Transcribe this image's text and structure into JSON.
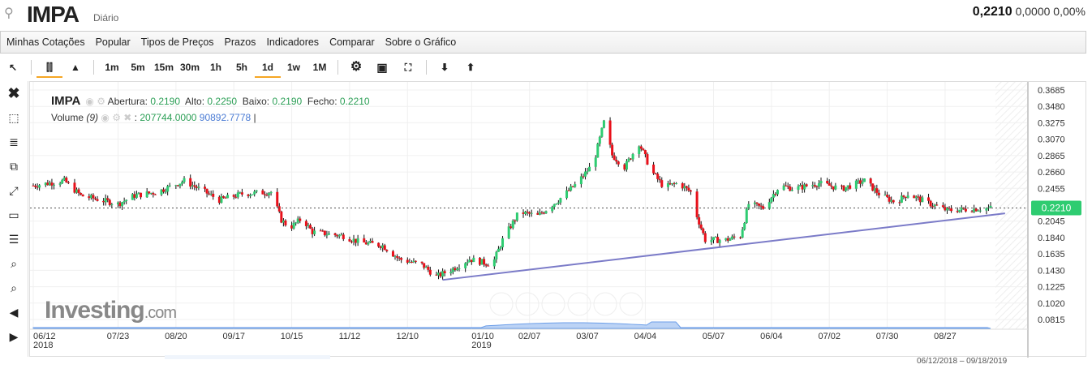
{
  "header": {
    "symbol": "IMPA",
    "period": "Diário",
    "price": "0,2210",
    "change": "0,0000",
    "change_pct": "0,00%"
  },
  "menu": [
    "Minhas Cotações",
    "Popular",
    "Tipos de Preços",
    "Prazos",
    "Indicadores",
    "Comparar",
    "Sobre o Gráfico"
  ],
  "toolbar": {
    "intervals": [
      "1m",
      "5m",
      "15m",
      "30m",
      "1h",
      "5h",
      "1d",
      "1w",
      "1M"
    ],
    "selected_interval": "1d",
    "icons": [
      "cursor-icon",
      "candlestick-icon",
      "area-chart-icon",
      "gear-icon",
      "camera-icon",
      "fullscreen-icon",
      "download-icon",
      "upload-icon"
    ]
  },
  "sidebar_icons": [
    "close-icon",
    "remove-drawings-icon",
    "fibonacci-icon",
    "clone-icon",
    "trendline-icon",
    "rectangle-icon",
    "horizontal-lines-icon",
    "zoom-in-icon",
    "zoom-out-icon",
    "scroll-left-icon",
    "scroll-right-icon"
  ],
  "legend": {
    "symbol": "IMPA",
    "open_label": "Abertura:",
    "open": "0.2190",
    "high_label": "Alto:",
    "high": "0.2250",
    "low_label": "Baixo:",
    "low": "0.2190",
    "close_label": "Fecho:",
    "close": "0.2210",
    "volume_label": "Volume",
    "volume_period": "(9)",
    "volume": "207744.0000",
    "volume_ma": "90892.7778"
  },
  "logo": {
    "main": "Investing",
    "suffix": ".com"
  },
  "date_range": "06/12/2018 – 09/18/2019",
  "chart_data": {
    "type": "candlestick",
    "colors": {
      "up": "#2ecc71",
      "down": "#e8101a",
      "trendline": "#7b7bc8",
      "last_price": "#2ecc71"
    },
    "ylim": [
      0.0815,
      0.3685
    ],
    "y_ticks": [
      "0.3685",
      "0.3480",
      "0.3275",
      "0.3070",
      "0.2865",
      "0.2660",
      "0.2455",
      "0.2045",
      "0.1840",
      "0.1635",
      "0.1430",
      "0.1225",
      "0.1020",
      "0.0815"
    ],
    "last_price": "0.2210",
    "x_ticks": [
      {
        "date": "2018-06-12",
        "label": "06/12",
        "sub": "2018"
      },
      {
        "date": "2018-07-23",
        "label": "07/23"
      },
      {
        "date": "2018-08-20",
        "label": "08/20"
      },
      {
        "date": "2018-09-17",
        "label": "09/17"
      },
      {
        "date": "2018-10-15",
        "label": "10/15"
      },
      {
        "date": "2018-11-12",
        "label": "11/12"
      },
      {
        "date": "2018-12-10",
        "label": "12/10"
      },
      {
        "date": "2019-01-10",
        "label": "01/10",
        "sub": "2019"
      },
      {
        "date": "2019-02-07",
        "label": "02/07"
      },
      {
        "date": "2019-03-07",
        "label": "03/07"
      },
      {
        "date": "2019-04-04",
        "label": "04/04"
      },
      {
        "date": "2019-05-07",
        "label": "05/07"
      },
      {
        "date": "2019-06-04",
        "label": "06/04"
      },
      {
        "date": "2019-07-02",
        "label": "07/02"
      },
      {
        "date": "2019-07-30",
        "label": "07/30"
      },
      {
        "date": "2019-08-27",
        "label": "08/27"
      }
    ],
    "closes": [
      [
        "2018-06-12",
        0.249
      ],
      [
        "2018-06-27",
        0.255
      ],
      [
        "2018-07-05",
        0.2365
      ],
      [
        "2018-07-23",
        0.226
      ],
      [
        "2018-07-31",
        0.2365
      ],
      [
        "2018-08-11",
        0.241
      ],
      [
        "2018-08-24",
        0.255
      ],
      [
        "2018-09-03",
        0.241
      ],
      [
        "2018-09-10",
        0.231
      ],
      [
        "2018-09-21",
        0.2385
      ],
      [
        "2018-10-05",
        0.241
      ],
      [
        "2018-10-10",
        0.206
      ],
      [
        "2018-10-14",
        0.196
      ],
      [
        "2018-10-20",
        0.208
      ],
      [
        "2018-10-25",
        0.191
      ],
      [
        "2018-11-09",
        0.186
      ],
      [
        "2018-11-17",
        0.178
      ],
      [
        "2018-11-28",
        0.174
      ],
      [
        "2018-12-06",
        0.157
      ],
      [
        "2018-12-17",
        0.15
      ],
      [
        "2018-12-24",
        0.135
      ],
      [
        "2019-01-01",
        0.145
      ],
      [
        "2019-01-09",
        0.157
      ],
      [
        "2019-01-20",
        0.15
      ],
      [
        "2019-01-25",
        0.181
      ],
      [
        "2019-02-02",
        0.216
      ],
      [
        "2019-02-11",
        0.211
      ],
      [
        "2019-02-21",
        0.231
      ],
      [
        "2019-03-02",
        0.252
      ],
      [
        "2019-03-10",
        0.277
      ],
      [
        "2019-03-15",
        0.328
      ],
      [
        "2019-03-19",
        0.287
      ],
      [
        "2019-03-25",
        0.272
      ],
      [
        "2019-04-01",
        0.302
      ],
      [
        "2019-04-07",
        0.267
      ],
      [
        "2019-04-13",
        0.247
      ],
      [
        "2019-04-20",
        0.252
      ],
      [
        "2019-04-26",
        0.241
      ],
      [
        "2019-04-29",
        0.211
      ],
      [
        "2019-05-03",
        0.181
      ],
      [
        "2019-05-13",
        0.181
      ],
      [
        "2019-05-20",
        0.186
      ],
      [
        "2019-05-24",
        0.226
      ],
      [
        "2019-05-31",
        0.221
      ],
      [
        "2019-06-08",
        0.249
      ],
      [
        "2019-06-15",
        0.245
      ],
      [
        "2019-06-27",
        0.252
      ],
      [
        "2019-07-08",
        0.245
      ],
      [
        "2019-07-19",
        0.255
      ],
      [
        "2019-07-27",
        0.2365
      ],
      [
        "2019-08-03",
        0.228
      ],
      [
        "2019-08-09",
        0.2385
      ],
      [
        "2019-08-18",
        0.228
      ],
      [
        "2019-08-28",
        0.218
      ],
      [
        "2019-09-18",
        0.221
      ]
    ],
    "trendline": [
      [
        "2018-12-27",
        0.131
      ],
      [
        "2019-09-25",
        0.2142
      ]
    ]
  }
}
